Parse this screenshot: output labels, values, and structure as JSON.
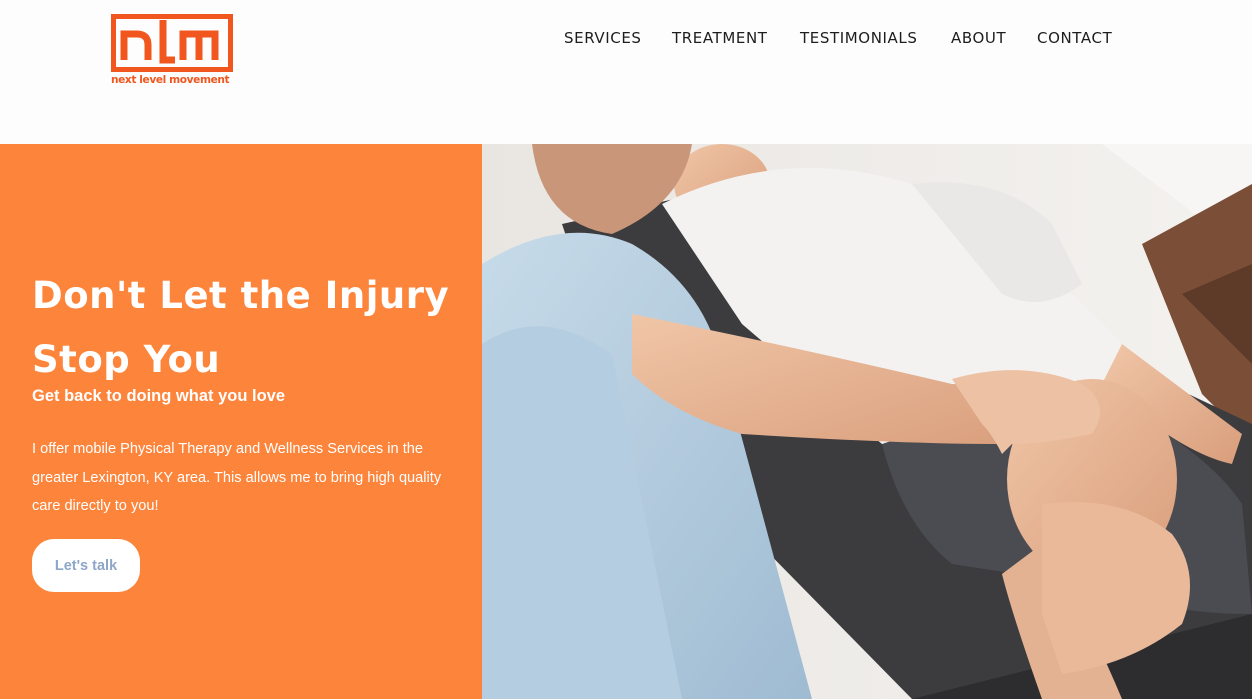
{
  "brand": {
    "logo_letters": "nlm",
    "logo_tagline": "next level movement",
    "color": "#f0561e"
  },
  "nav": {
    "items": [
      {
        "label": "SERVICES"
      },
      {
        "label": "TREATMENT"
      },
      {
        "label": "TESTIMONIALS"
      },
      {
        "label": "ABOUT"
      },
      {
        "label": "CONTACT"
      }
    ]
  },
  "hero": {
    "title": "Don't Let the Injury Stop You",
    "subtitle": "Get back to doing what you love",
    "body": "I offer mobile Physical Therapy and Wellness Services in the greater Lexington, KY area. This allows me to bring high quality care directly to you!",
    "cta_label": "Let's talk",
    "background_color": "#fd843b",
    "cta_text_color": "#8ea6c8",
    "image_subject": "physical therapist examining patient's knee"
  }
}
